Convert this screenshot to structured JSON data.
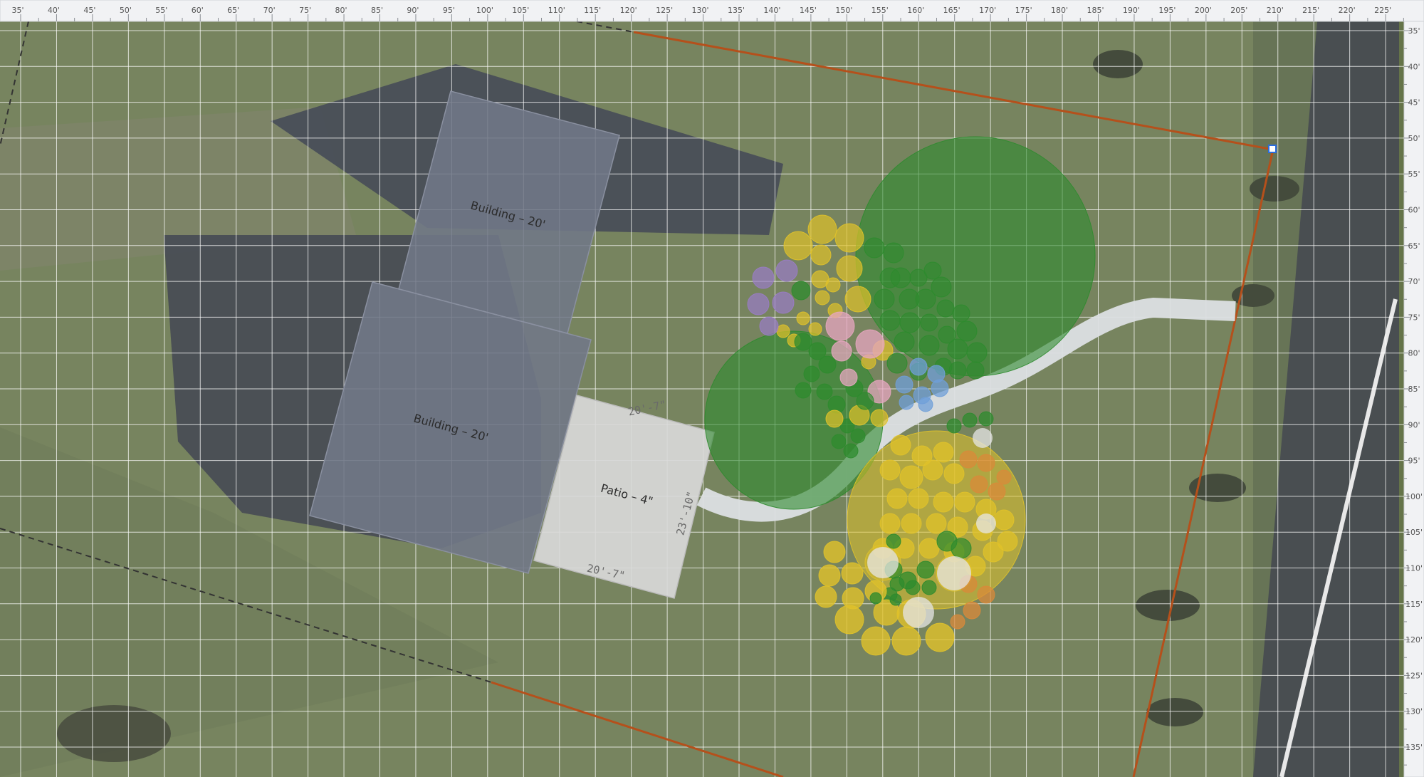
{
  "ruler": {
    "top_labels": [
      "35'",
      "40'",
      "45'",
      "50'",
      "55'",
      "60'",
      "65'",
      "70'",
      "75'",
      "80'",
      "85'",
      "90'",
      "95'",
      "100'",
      "105'",
      "110'",
      "115'",
      "120'",
      "125'",
      "130'",
      "135'",
      "140'",
      "145'",
      "150'",
      "155'",
      "160'",
      "165'",
      "170'",
      "175'",
      "180'",
      "185'",
      "190'",
      "195'",
      "200'",
      "205'",
      "210'",
      "215'",
      "220'",
      "225'"
    ],
    "right_labels": [
      "35'",
      "40'",
      "45'",
      "50'",
      "55'",
      "60'",
      "65'",
      "70'",
      "75'",
      "80'",
      "85'",
      "90'",
      "95'",
      "100'",
      "105'",
      "110'",
      "115'",
      "120'",
      "125'",
      "130'",
      "135'"
    ]
  },
  "shapes": {
    "building_1_label": "Building – 20'",
    "building_2_label": "Building – 20'",
    "patio_label": "Patio – 4\"",
    "patio_dim_top": "20'-7\"",
    "patio_dim_bottom": "20'-7\"",
    "patio_dim_side": "23'-10\""
  },
  "colors": {
    "property_line": "#b5501b",
    "building_fill": "#717887",
    "patio_fill": "#d9d9d9",
    "walkway": "#dcdfe3",
    "tree_green": "#2e8b2e",
    "yellow_plant": "#e0c22a",
    "purple_plant": "#9a7cc8",
    "pink_plant": "#e7a6c0",
    "blue_plant": "#6f9fd8",
    "orange_plant": "#d98a3a",
    "grass_base": "#617049",
    "grid_line": "#ffffff"
  }
}
